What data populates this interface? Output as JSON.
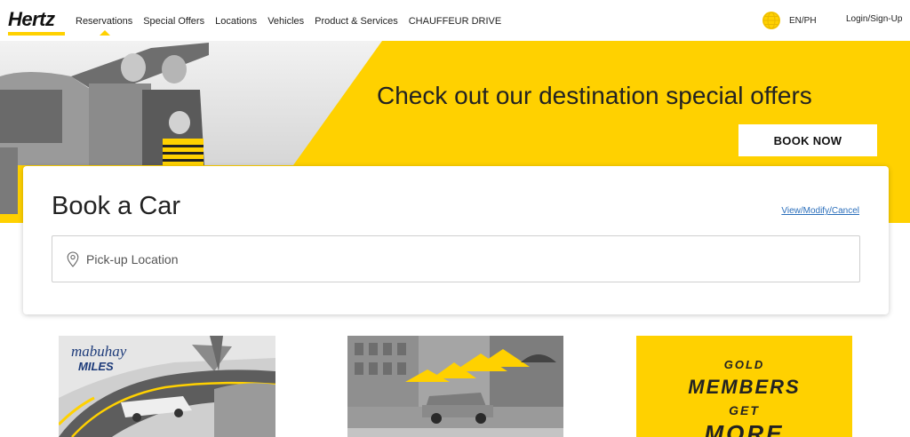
{
  "brand": {
    "logo_text": "Hertz"
  },
  "nav": {
    "items": [
      {
        "label": "Reservations"
      },
      {
        "label": "Special Offers"
      },
      {
        "label": "Locations"
      },
      {
        "label": "Vehicles"
      },
      {
        "label": "Product & Services"
      },
      {
        "label": "CHAUFFEUR DRIVE"
      }
    ],
    "language": "EN/PH",
    "login": "Login/Sign-Up"
  },
  "hero": {
    "title": "Check out our destination special offers",
    "cta": "BOOK NOW"
  },
  "booking": {
    "title": "Book a Car",
    "modify_link": "View/Modify/Cancel",
    "pickup_placeholder": "Pick-up Location"
  },
  "promos": {
    "mabuhay_logo": "mabuhay",
    "mabuhay_miles": "MILES",
    "gold_line1": "GOLD",
    "gold_line2": "MEMBERS",
    "gold_line3": "GET",
    "gold_line4": "MORE"
  },
  "colors": {
    "brand_yellow": "#ffd100",
    "link_blue": "#2a6ebb",
    "text_dark": "#222222"
  },
  "icons": [
    "globe-icon",
    "location-pin-icon"
  ]
}
